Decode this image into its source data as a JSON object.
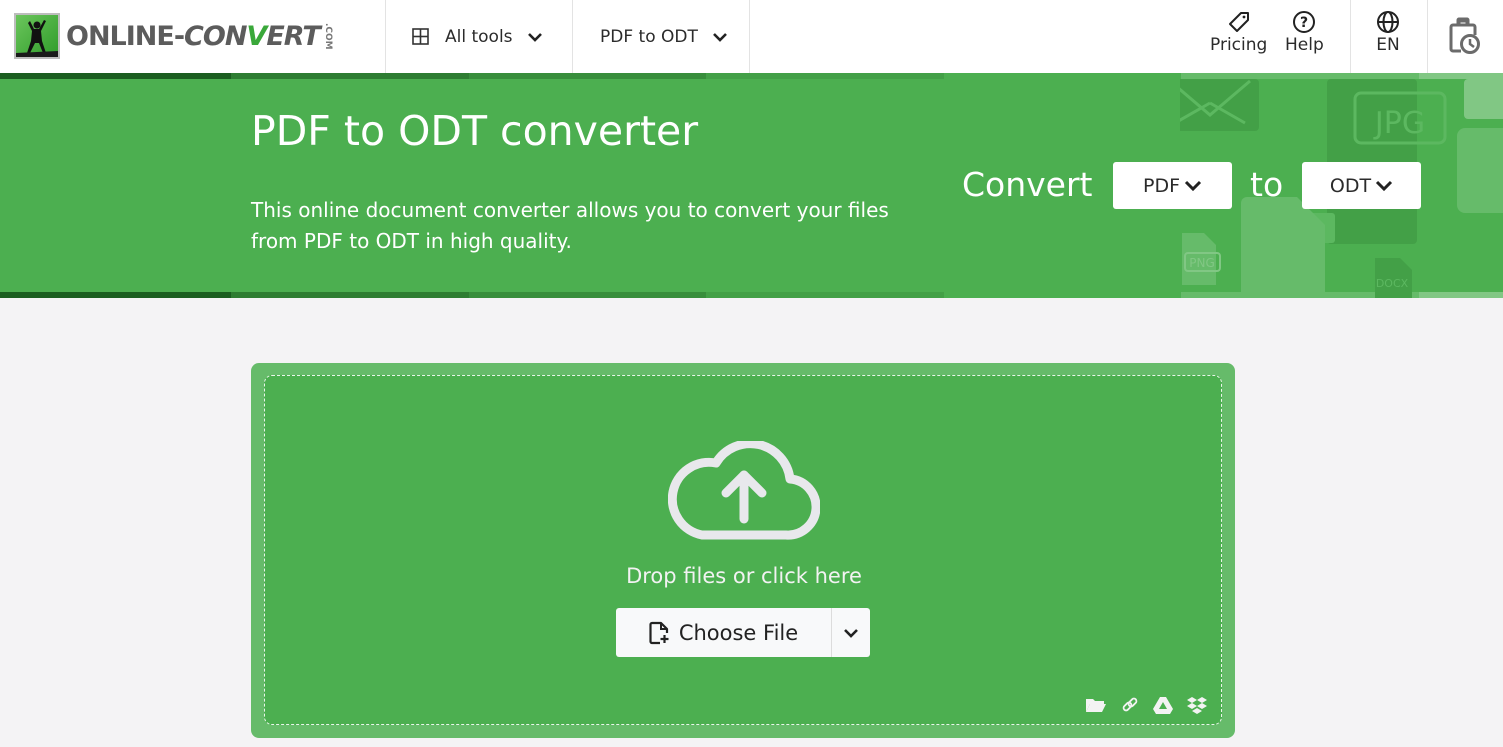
{
  "brand": {
    "name_part1": "ONLINE-",
    "name_part2_a": "CON",
    "name_part2_v": "V",
    "name_part2_b": "ERT",
    "tld": ".COM"
  },
  "nav": {
    "all_tools_label": "All tools",
    "converter_label": "PDF to ODT",
    "pricing_label": "Pricing",
    "help_label": "Help",
    "language_label": "EN"
  },
  "hero": {
    "title": "PDF to ODT converter",
    "description": "This online document converter allows you to convert your files from PDF to ODT in high quality.",
    "convert_label": "Convert",
    "to_label": "to",
    "from_format": "PDF",
    "to_format": "ODT",
    "bg_file_labels": [
      "JPG",
      "PNG",
      "DOCX"
    ]
  },
  "upload": {
    "drop_text": "Drop files or click here",
    "choose_file_label": "Choose File",
    "sources": [
      "folder-icon",
      "link-icon",
      "google-drive-icon",
      "dropbox-icon"
    ]
  },
  "colors": {
    "brand_green": "#4caf50",
    "light_green": "#66bb6a",
    "page_bg": "#f4f3f5"
  }
}
